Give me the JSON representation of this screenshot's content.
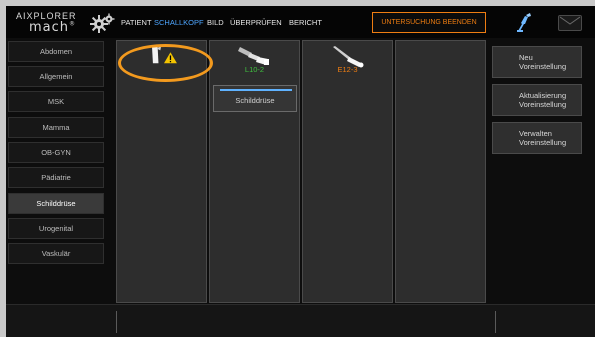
{
  "logo": {
    "brand": "AIXPLORER",
    "model": "mach",
    "model_suffix": "®"
  },
  "menu": [
    {
      "label": "PATIENT",
      "active": false
    },
    {
      "label": "SCHALLKOPF",
      "active": true
    },
    {
      "label": "BILD",
      "active": false
    },
    {
      "label": "ÜBERPRÜFEN",
      "active": false
    },
    {
      "label": "BERICHT",
      "active": false
    }
  ],
  "end_exam_label": "UNTERSUCHUNG BEENDEN",
  "presets_left": [
    "Abdomen",
    "Allgemein",
    "MSK",
    "Mamma",
    "OB-GYN",
    "Pädiatrie",
    "Schilddrüse",
    "Urogenital",
    "Vaskulär"
  ],
  "selected_preset": "Schilddrüse",
  "probe_slots": [
    {
      "icon": "warning-probe-icon",
      "label": "",
      "label_color": "#e8e8e8"
    },
    {
      "icon": "linear-probe-icon",
      "label": "L10-2",
      "label_color": "#3fbf3f",
      "preset": "Schilddrüse"
    },
    {
      "icon": "endocavity-probe-icon",
      "label": "E12-3",
      "label_color": "#ee7d12"
    },
    {
      "icon": "empty-slot",
      "label": ""
    }
  ],
  "right_actions": [
    {
      "line1": "Neu",
      "line2": "Voreinstellung"
    },
    {
      "line1": "Aktualisierung",
      "line2": "Voreinstellung"
    },
    {
      "line1": "Verwalten",
      "line2": "Voreinstellung"
    }
  ],
  "colors": {
    "accent": "#4ea6ff",
    "warning": "#f4c400",
    "highlight": "#f39a1e",
    "end_exam": "#ee7d12"
  }
}
